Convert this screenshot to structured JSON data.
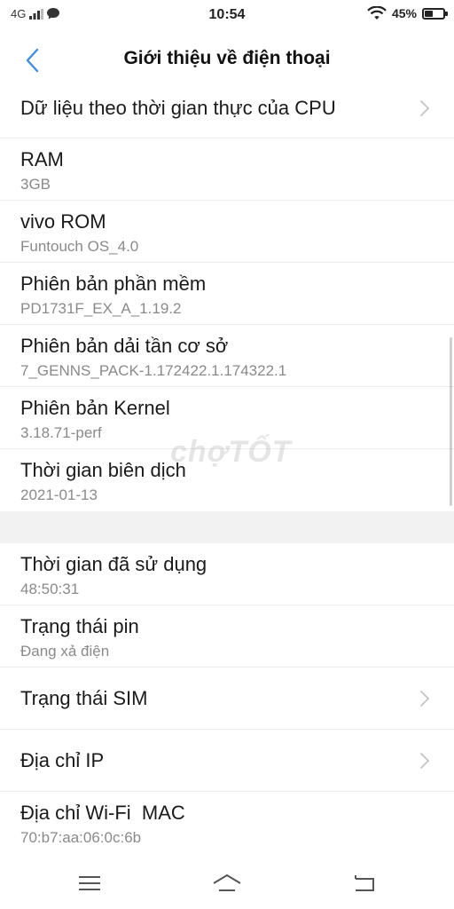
{
  "status_bar": {
    "network": "4G",
    "time": "10:54",
    "battery_percent": "45%",
    "battery_level": 0.45
  },
  "header": {
    "title": "Giới thiệu về điện thoại",
    "back_icon": "chevron-left-icon"
  },
  "rows": {
    "cpu": {
      "title": "Dữ liệu theo thời gian thực của CPU"
    },
    "ram": {
      "title": "RAM",
      "value": "3GB"
    },
    "rom": {
      "title": "vivo ROM",
      "value": "Funtouch OS_4.0"
    },
    "software": {
      "title": "Phiên bản phần mềm",
      "value": "PD1731F_EX_A_1.19.2"
    },
    "baseband": {
      "title": "Phiên bản dải tần cơ sở",
      "value": "7_GENNS_PACK-1.172422.1.174322.1"
    },
    "kernel": {
      "title": "Phiên bản Kernel",
      "value": "3.18.71-perf"
    },
    "build_time": {
      "title": "Thời gian biên dịch",
      "value": "2021-01-13"
    },
    "uptime": {
      "title": "Thời gian đã sử dụng",
      "value": "48:50:31"
    },
    "battery": {
      "title": "Trạng thái pin",
      "value": "Đang xả điện"
    },
    "sim": {
      "title": "Trạng thái SIM"
    },
    "ip": {
      "title": "Địa chỉ IP"
    },
    "wifi_mac": {
      "title": "Địa chỉ Wi-Fi  MAC",
      "value": "70:b7:aa:06:0c:6b"
    }
  },
  "watermark": "chợTỐT",
  "colors": {
    "accent": "#3a8ee6",
    "text_primary": "#1a1a1a",
    "text_secondary": "#8a8a8a",
    "section_gap": "#f2f2f2"
  }
}
